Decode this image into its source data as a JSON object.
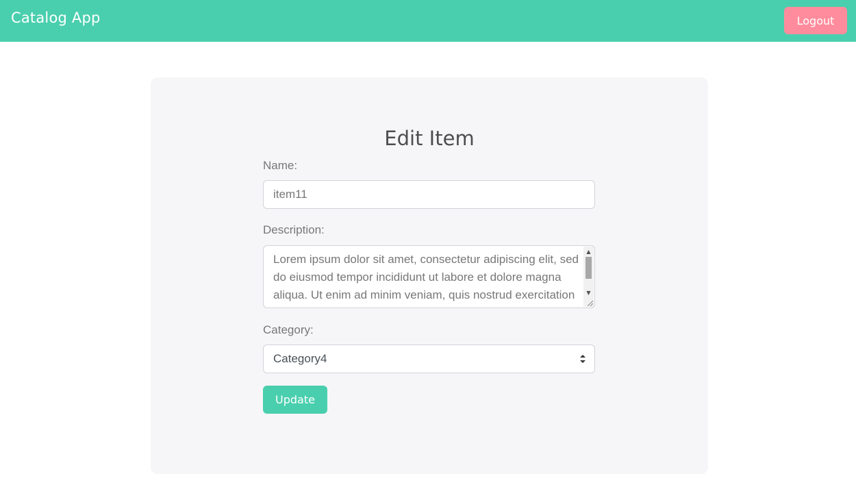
{
  "navbar": {
    "brand": "Catalog App",
    "logout_label": "Logout",
    "color": "#4acfae",
    "logout_color": "#ff8c9c"
  },
  "form": {
    "title": "Edit Item",
    "name_label": "Name:",
    "name_value": "item11",
    "description_label": "Description:",
    "description_value": "Lorem ipsum dolor sit amet, consectetur adipiscing elit, sed do eiusmod tempor incididunt ut labore et dolore magna aliqua. Ut enim ad minim veniam, quis nostrud exercitation ullamco laboris nisi ut aliquip ex ea commodo consequat.",
    "category_label": "Category:",
    "category_selected": "Category4",
    "update_label": "Update"
  }
}
